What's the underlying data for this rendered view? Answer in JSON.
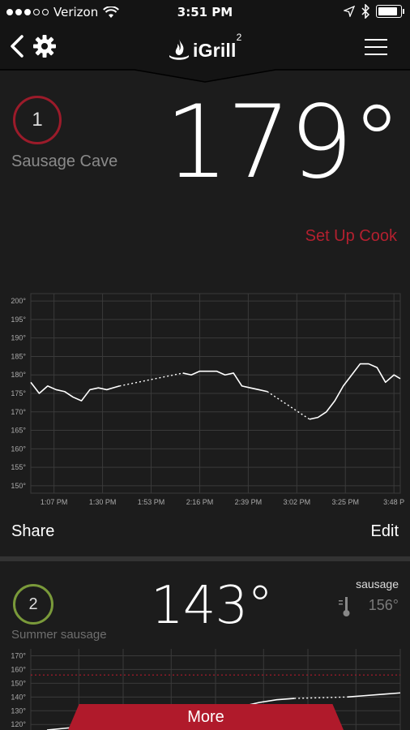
{
  "status": {
    "carrier": "Verizon",
    "time": "3:51 PM"
  },
  "nav": {
    "logo": "iGrill",
    "logo_sup": "2"
  },
  "probe1": {
    "number": "1",
    "name": "Sausage Cave",
    "temperature": "179°",
    "setup_label": "Set Up Cook",
    "share_label": "Share",
    "edit_label": "Edit",
    "badge_color": "#9b1b2a"
  },
  "probe2": {
    "number": "2",
    "name": "Summer sausage",
    "temperature": "143°",
    "target_label": "sausage",
    "target_temp": "156°",
    "badge_color": "#7a9a3a"
  },
  "more_label": "More",
  "colors": {
    "accent": "#b01a2b",
    "background": "#1c1c1c"
  },
  "chart_data": [
    {
      "type": "line",
      "y_ticks": [
        "200°",
        "195°",
        "190°",
        "185°",
        "180°",
        "175°",
        "170°",
        "165°",
        "160°",
        "155°",
        "150°"
      ],
      "x_ticks": [
        "1:07 PM",
        "1:30 PM",
        "1:53 PM",
        "2:16 PM",
        "2:39 PM",
        "3:02 PM",
        "3:25 PM",
        "3:48 P"
      ],
      "ylim": [
        148,
        202
      ],
      "grid": true,
      "series": [
        {
          "x": [
            "12:56 PM",
            "1:00 PM",
            "1:04 PM",
            "1:08 PM",
            "1:12 PM",
            "1:16 PM",
            "1:20 PM",
            "1:24 PM",
            "1:28 PM",
            "1:32 PM",
            "1:35 PM",
            "1:38 PM",
            "2:08 PM",
            "2:12 PM",
            "2:16 PM",
            "2:20 PM",
            "2:24 PM",
            "2:28 PM",
            "2:32 PM",
            "2:36 PM",
            "2:40 PM",
            "2:44 PM",
            "2:48 PM",
            "3:08 PM",
            "3:12 PM",
            "3:16 PM",
            "3:20 PM",
            "3:24 PM",
            "3:28 PM",
            "3:32 PM",
            "3:36 PM",
            "3:40 PM",
            "3:44 PM",
            "3:48 PM",
            "3:51 PM"
          ],
          "y": [
            178,
            175,
            177,
            176,
            175.5,
            174,
            173,
            176,
            176.5,
            176,
            176.5,
            177,
            180.5,
            180,
            181,
            181,
            181,
            180,
            180.5,
            177,
            176.5,
            176,
            175.5,
            168,
            168.5,
            170,
            173,
            177,
            180,
            183,
            183,
            182,
            178,
            180,
            179
          ]
        }
      ],
      "dashed_segments": [
        [
          "1:38 PM",
          "2:08 PM"
        ],
        [
          "2:48 PM",
          "3:08 PM"
        ]
      ]
    },
    {
      "type": "line",
      "y_ticks": [
        "170°",
        "160°",
        "150°",
        "140°",
        "130°",
        "120°"
      ],
      "ylim": [
        116,
        175
      ],
      "grid": true,
      "target_line": 156,
      "series": [
        {
          "x": [
            0,
            0.08,
            0.13,
            0.2,
            0.3,
            0.4,
            0.5,
            0.55,
            0.6,
            0.65,
            0.7,
            0.78,
            0.85,
            0.9,
            0.95,
            1.0
          ],
          "y": [
            116,
            118,
            120,
            122,
            125,
            128,
            131,
            133,
            136,
            138,
            139,
            140,
            140,
            141,
            142,
            143
          ]
        }
      ]
    }
  ]
}
